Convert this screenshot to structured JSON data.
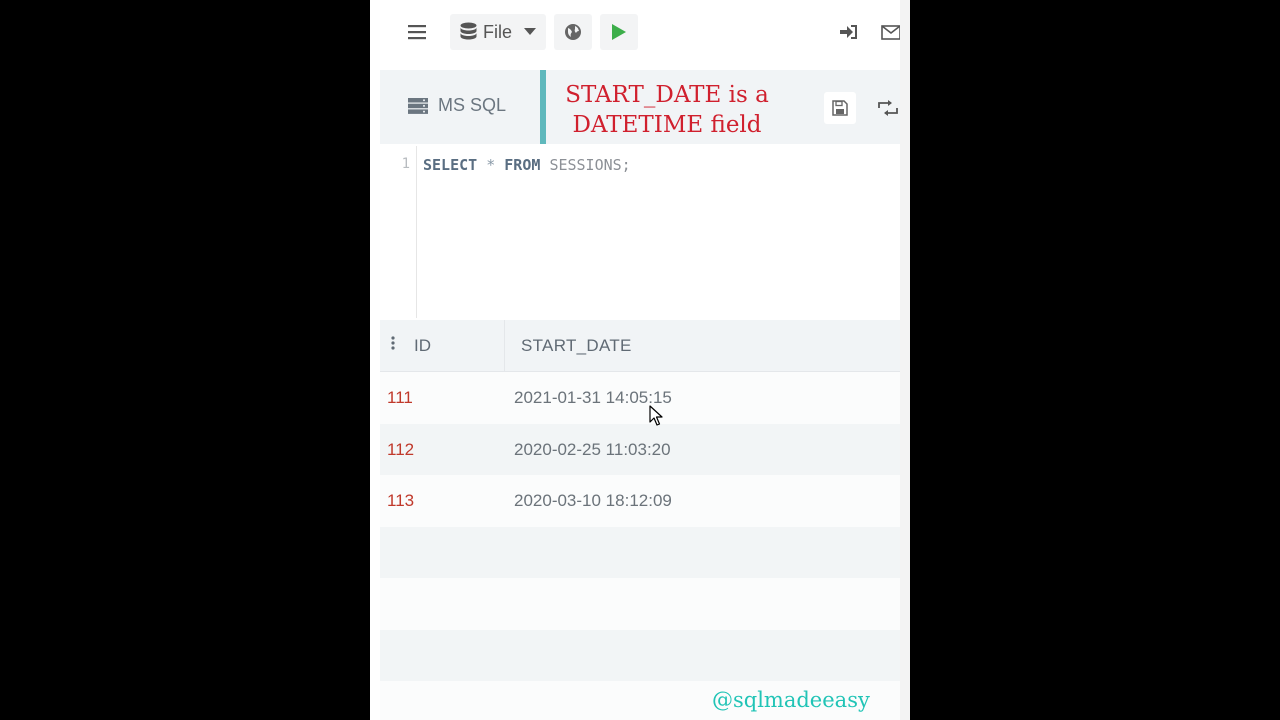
{
  "toolbar": {
    "menu_icon": "hamburger-icon",
    "file_label": "File",
    "globe_icon": "globe-icon",
    "run_icon": "play-icon",
    "login_icon": "sign-in-icon",
    "mail_icon": "envelope-icon"
  },
  "editor_header": {
    "language": "MS SQL",
    "annotation_line1": "START_DATE is a",
    "annotation_line2": "DATETIME field",
    "accent_color": "#5fb8bc",
    "annotation_color": "#d0202e"
  },
  "editor": {
    "line_number": "1",
    "kw_select": "SELECT",
    "star": "*",
    "kw_from": "FROM",
    "table": "SESSIONS;"
  },
  "results": {
    "columns": [
      "ID",
      "START_DATE"
    ],
    "rows": [
      {
        "id": "111",
        "start_date": "2021-01-31 14:05:15"
      },
      {
        "id": "112",
        "start_date": "2020-02-25 11:03:20"
      },
      {
        "id": "113",
        "start_date": "2020-03-10 18:12:09"
      }
    ],
    "id_color": "#c0392b"
  },
  "watermark": "@sqlmadeeasy",
  "watermark_color": "#21c4b6"
}
